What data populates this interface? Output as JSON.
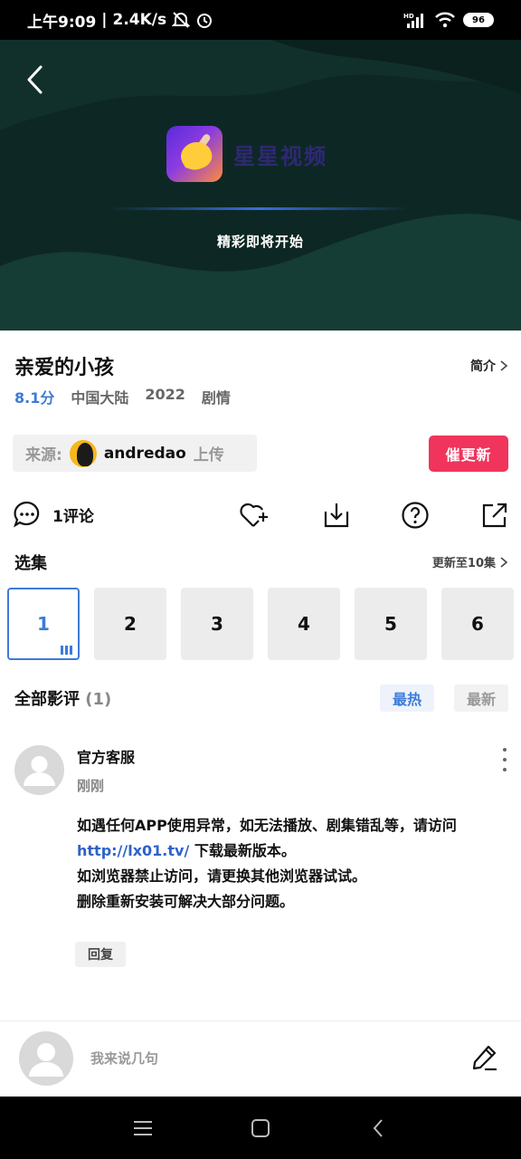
{
  "status_bar": {
    "time": "上午9:09",
    "network_speed": "2.4K/s",
    "battery": "96",
    "signal_label": "HD"
  },
  "player": {
    "app_name": "星星视频",
    "loading_text": "精彩即将开始"
  },
  "video": {
    "title": "亲爱的小孩",
    "intro_label": "简介",
    "score": "8.1分",
    "region": "中国大陆",
    "year": "2022",
    "genre": "剧情"
  },
  "source": {
    "label": "来源:",
    "uploader": "andredao",
    "suffix": "上传",
    "urge_button": "催更新"
  },
  "actions": {
    "comment_label": "1评论"
  },
  "episodes": {
    "title": "选集",
    "update_label": "更新至10集",
    "items": [
      "1",
      "2",
      "3",
      "4",
      "5",
      "6"
    ],
    "active_index": 0
  },
  "reviews": {
    "title": "全部影评",
    "count": "(1)",
    "sort_hot": "最热",
    "sort_new": "最新",
    "items": [
      {
        "user": "官方客服",
        "time": "刚刚",
        "line1": "如遇任何APP使用异常，如无法播放、剧集错乱等，请访问",
        "link": "http://lx01.tv/",
        "line2": " 下载最新版本。",
        "line3": "如浏览器禁止访问，请更换其他浏览器试试。",
        "line4": "删除重新安装可解决大部分问题。",
        "reply_label": "回复"
      }
    ]
  },
  "comment_input": {
    "placeholder": "我来说几句"
  },
  "colors": {
    "accent_blue": "#3d7bd9",
    "urge_red": "#f0345c",
    "player_bg": "#0f2a26"
  }
}
